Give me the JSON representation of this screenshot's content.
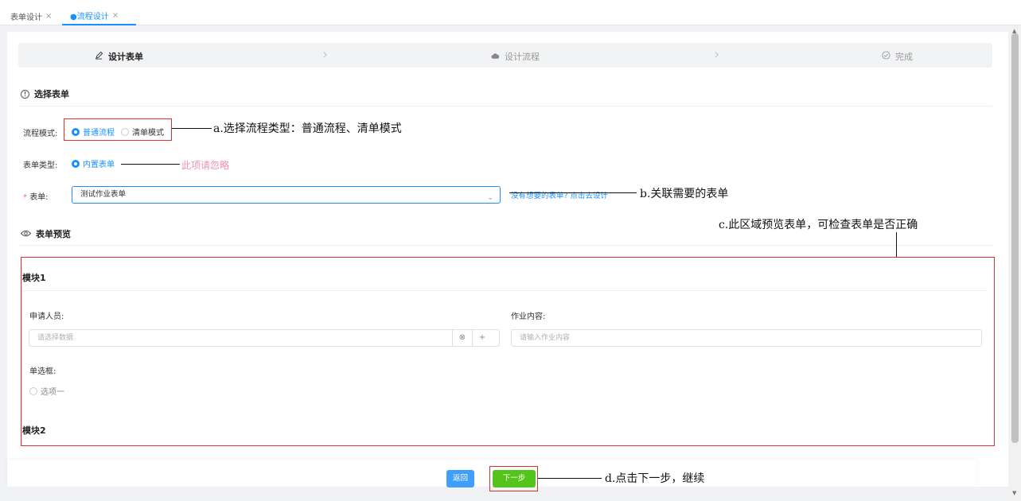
{
  "tabs": [
    {
      "label": "表单设计",
      "close": "×"
    },
    {
      "label": "●流程设计",
      "close": "×"
    }
  ],
  "steps": [
    {
      "label": "设计表单",
      "icon": "pencil-icon"
    },
    {
      "label": "设计流程",
      "icon": "cloud-icon"
    },
    {
      "label": "完成",
      "icon": "check-circle-icon"
    }
  ],
  "section_select_form": {
    "title": "选择表单"
  },
  "form": {
    "flow_mode_label": "流程模式:",
    "flow_mode_options": [
      "普通流程",
      "清单模式"
    ],
    "flow_mode_selected": "普通流程",
    "form_type_label": "表单类型:",
    "form_type_option": "内置表单",
    "form_required_mark": "*",
    "form_label": "表单:",
    "form_value": "测试作业表单",
    "form_link": "没有想要的表单? 点击去设计"
  },
  "section_preview": {
    "title": "表单预览"
  },
  "preview": {
    "module1": "模块1",
    "applicant_label": "申请人员:",
    "applicant_placeholder": "请选择数据",
    "applicant_clear": "⊗",
    "applicant_add": "+",
    "content_label": "作业内容:",
    "content_placeholder": "请输入作业内容",
    "radio_label": "单选框:",
    "radio_option": "选项一",
    "module2": "模块2"
  },
  "footer": {
    "back_label": "返回",
    "next_label": "下一步"
  },
  "annotations": {
    "a": "a.选择流程类型：普通流程、清单模式",
    "ignore": "此项请忽略",
    "b": "b.关联需要的表单",
    "c": "c.此区域预览表单，可检查表单是否正确",
    "d": "d.点击下一步，继续"
  },
  "colors": {
    "accent": "#1890ff",
    "annotation_box": "#e03131",
    "next_button": "#52c41a",
    "back_button": "#409eff"
  }
}
